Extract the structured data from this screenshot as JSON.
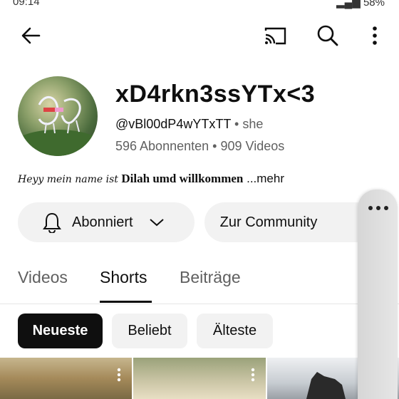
{
  "statusbar": {
    "time": "09:14",
    "battery": "58%"
  },
  "channel": {
    "name": "xD4rkn3ssYTx<3",
    "handle": "@vBl00dP4wYTxTT",
    "separator": "•",
    "pronouns": "she",
    "subscribers": "596 Abonnenten",
    "videos": "909 Videos"
  },
  "description": {
    "script_text": "Heyy mein name ist",
    "serif_text": "Dilah umd willkommen",
    "more": " ...mehr"
  },
  "actions": {
    "subscribe_label": "Abonniert",
    "community_label": "Zur Community"
  },
  "tabs": [
    {
      "label": "Videos",
      "active": false
    },
    {
      "label": "Shorts",
      "active": true
    },
    {
      "label": "Beiträge",
      "active": false
    }
  ],
  "chips": [
    {
      "label": "Neueste",
      "selected": true
    },
    {
      "label": "Beliebt",
      "selected": false
    },
    {
      "label": "Älteste",
      "selected": false
    }
  ],
  "icons": {
    "back": "arrow-left-icon",
    "cast": "cast-icon",
    "search": "search-icon",
    "more": "more-vertical-icon",
    "bell": "bell-icon",
    "chevron": "chevron-down-icon"
  },
  "colors": {
    "text": "#0f0f0f",
    "secondary": "#606060",
    "chip_bg": "#f2f2f2",
    "chip_selected": "#0f0f0f"
  }
}
